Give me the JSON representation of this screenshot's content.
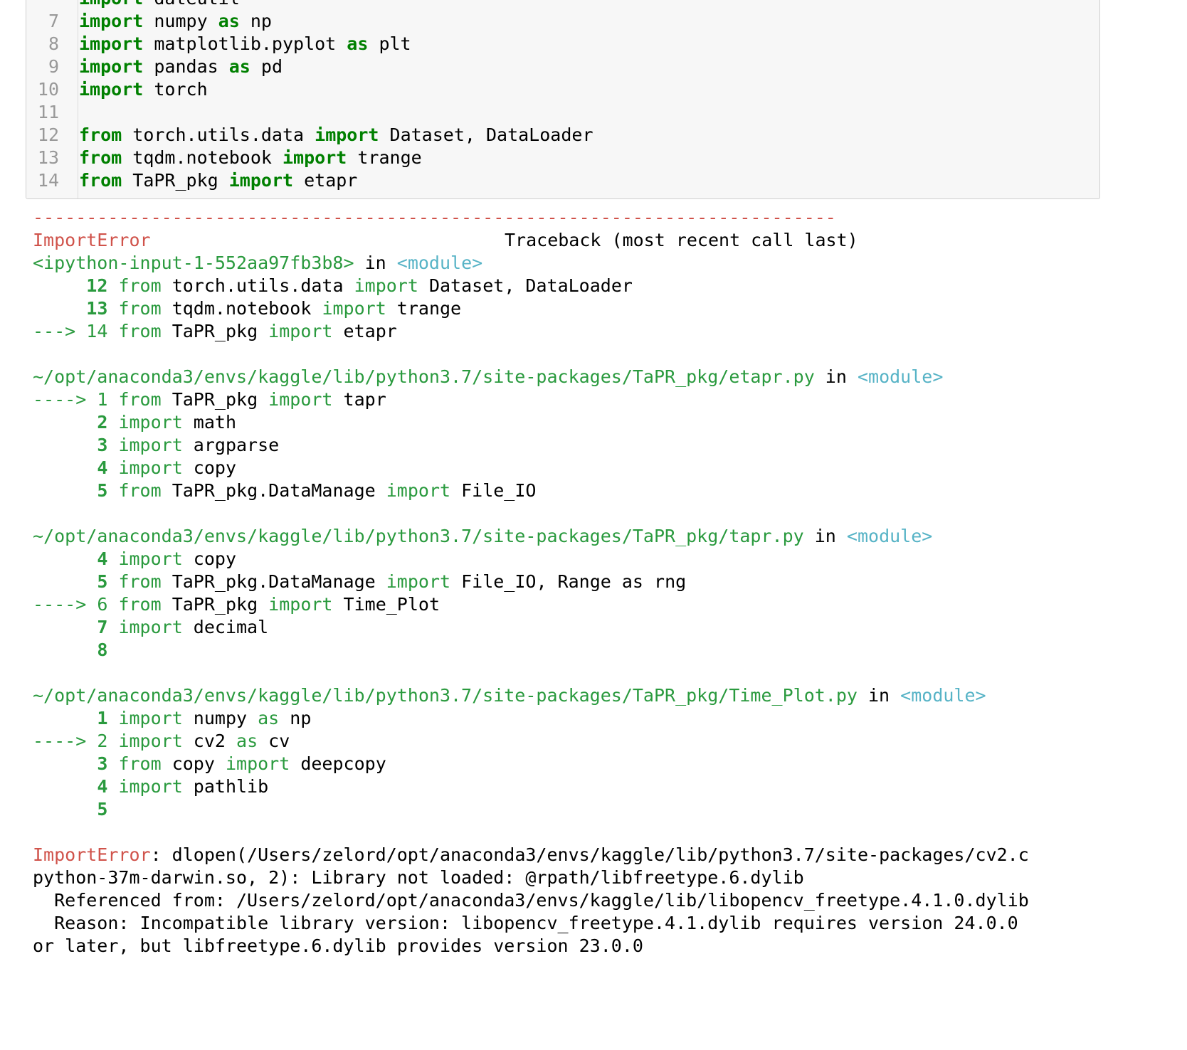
{
  "cell": {
    "partial_top_line": "import dateutil",
    "lines": [
      {
        "n": "7",
        "kw1": "import",
        "a": " numpy ",
        "kw2": "as",
        "b": " np"
      },
      {
        "n": "8",
        "kw1": "import",
        "a": " matplotlib.pyplot ",
        "kw2": "as",
        "b": " plt"
      },
      {
        "n": "9",
        "kw1": "import",
        "a": " pandas ",
        "kw2": "as",
        "b": " pd"
      },
      {
        "n": "10",
        "kw1": "import",
        "a": " torch",
        "kw2": "",
        "b": ""
      },
      {
        "n": "11",
        "kw1": "",
        "a": "",
        "kw2": "",
        "b": ""
      },
      {
        "n": "12",
        "kw1": "from",
        "a": " torch.utils.data ",
        "kw2": "import",
        "b": " Dataset, DataLoader"
      },
      {
        "n": "13",
        "kw1": "from",
        "a": " tqdm.notebook ",
        "kw2": "import",
        "b": " trange"
      },
      {
        "n": "14",
        "kw1": "from",
        "a": " TaPR_pkg ",
        "kw2": "import",
        "b": " etapr"
      }
    ]
  },
  "traceback": {
    "dashes": "---------------------------------------------------------------------------",
    "error_name": "ImportError",
    "header_right": "Traceback (most recent call last)",
    "input_ref": "<ipython-input-1-552aa97fb3b8>",
    "in_word": " in ",
    "module_tag": "<module>",
    "frame1": [
      {
        "arrow": "     ",
        "n": "12",
        "kw": "from",
        "rest": " torch.utils.data ",
        "kw2": "import",
        "tail": " Dataset, DataLoader"
      },
      {
        "arrow": "     ",
        "n": "13",
        "kw": "from",
        "rest": " tqdm.notebook ",
        "kw2": "import",
        "tail": " trange"
      },
      {
        "arrow": "---> ",
        "n": "14",
        "kw": "from",
        "rest": " TaPR_pkg ",
        "kw2": "import",
        "tail": " etapr"
      }
    ],
    "path2": "~/opt/anaconda3/envs/kaggle/lib/python3.7/site-packages/TaPR_pkg/etapr.py",
    "frame2": [
      {
        "arrow": "----> ",
        "n": "1",
        "kw": "from",
        "rest": " TaPR_pkg ",
        "kw2": "import",
        "tail": " tapr"
      },
      {
        "arrow": "      ",
        "n": "2",
        "kw": "import",
        "rest": " math",
        "kw2": "",
        "tail": ""
      },
      {
        "arrow": "      ",
        "n": "3",
        "kw": "import",
        "rest": " argparse",
        "kw2": "",
        "tail": ""
      },
      {
        "arrow": "      ",
        "n": "4",
        "kw": "import",
        "rest": " copy",
        "kw2": "",
        "tail": ""
      },
      {
        "arrow": "      ",
        "n": "5",
        "kw": "from",
        "rest": " TaPR_pkg.DataManage ",
        "kw2": "import",
        "tail": " File_IO"
      }
    ],
    "path3": "~/opt/anaconda3/envs/kaggle/lib/python3.7/site-packages/TaPR_pkg/tapr.py",
    "frame3": [
      {
        "arrow": "      ",
        "n": "4",
        "kw": "import",
        "rest": " copy",
        "kw2": "",
        "tail": ""
      },
      {
        "arrow": "      ",
        "n": "5",
        "kw": "from",
        "rest": " TaPR_pkg.DataManage ",
        "kw2": "import",
        "tail": " File_IO, Range as rng"
      },
      {
        "arrow": "----> ",
        "n": "6",
        "kw": "from",
        "rest": " TaPR_pkg ",
        "kw2": "import",
        "tail": " Time_Plot"
      },
      {
        "arrow": "      ",
        "n": "7",
        "kw": "import",
        "rest": " decimal",
        "kw2": "",
        "tail": ""
      },
      {
        "arrow": "      ",
        "n": "8",
        "kw": "",
        "rest": "",
        "kw2": "",
        "tail": ""
      }
    ],
    "path4": "~/opt/anaconda3/envs/kaggle/lib/python3.7/site-packages/TaPR_pkg/Time_Plot.py",
    "frame4": [
      {
        "arrow": "      ",
        "n": "1",
        "kw": "import",
        "rest": " numpy ",
        "kw2": "as",
        "tail": " np"
      },
      {
        "arrow": "----> ",
        "n": "2",
        "kw": "import",
        "rest": " cv2 ",
        "kw2": "as",
        "tail": " cv"
      },
      {
        "arrow": "      ",
        "n": "3",
        "kw": "from",
        "rest": " copy ",
        "kw2": "import",
        "tail": " deepcopy"
      },
      {
        "arrow": "      ",
        "n": "4",
        "kw": "import",
        "rest": " pathlib",
        "kw2": "",
        "tail": ""
      },
      {
        "arrow": "      ",
        "n": "5",
        "kw": "",
        "rest": "",
        "kw2": "",
        "tail": ""
      }
    ],
    "final_error_name": "ImportError",
    "final_lines": [
      ": dlopen(/Users/zelord/opt/anaconda3/envs/kaggle/lib/python3.7/site-packages/cv2.c",
      "python-37m-darwin.so, 2): Library not loaded: @rpath/libfreetype.6.dylib",
      "  Referenced from: /Users/zelord/opt/anaconda3/envs/kaggle/lib/libopencv_freetype.4.1.0.dylib",
      "  Reason: Incompatible library version: libopencv_freetype.4.1.dylib requires version 24.0.0",
      "or later, but libfreetype.6.dylib provides version 23.0.0"
    ]
  }
}
